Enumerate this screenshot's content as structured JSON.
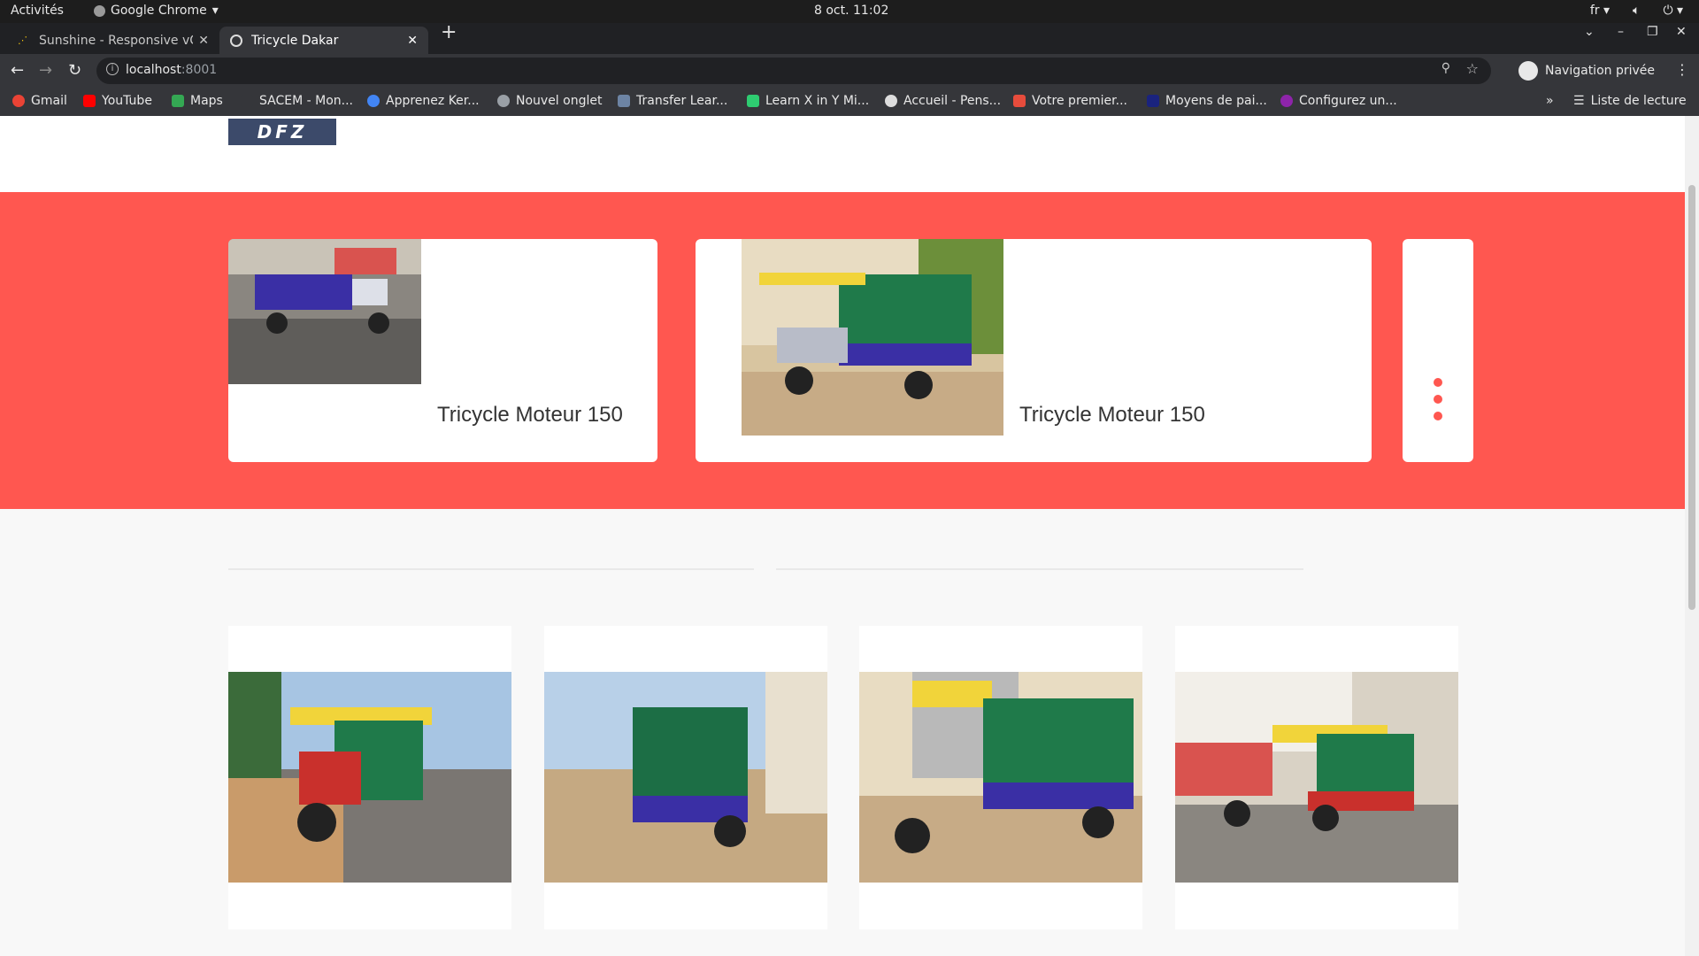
{
  "os": {
    "activities": "Activités",
    "app_name": "Google Chrome",
    "clock": "8 oct.  11:02",
    "lang": "fr"
  },
  "browser": {
    "tabs": [
      {
        "title": "Sunshine - Responsive vCa",
        "active": false
      },
      {
        "title": "Tricycle Dakar",
        "active": true
      }
    ],
    "url_host": "localhost",
    "url_port": ":8001",
    "profile_label": "Navigation privée",
    "bookmarks": [
      {
        "label": "Gmail",
        "color": "#ea4335"
      },
      {
        "label": "YouTube",
        "color": "#ff0000"
      },
      {
        "label": "Maps",
        "color": "#34a853"
      },
      {
        "label": "SACEM - Mon...",
        "color": "#35363a"
      },
      {
        "label": "Apprenez Ker...",
        "color": "#4285f4"
      },
      {
        "label": "Nouvel onglet",
        "color": "#9aa0a6"
      },
      {
        "label": "Transfer Lear...",
        "color": "#6d84a4"
      },
      {
        "label": "Learn X in Y Mi...",
        "color": "#2ecc71"
      },
      {
        "label": "Accueil - Pens...",
        "color": "#dddddd"
      },
      {
        "label": "Votre premier...",
        "color": "#e74c3c"
      },
      {
        "label": "Moyens de pai...",
        "color": "#1a237e"
      },
      {
        "label": "Configurez un...",
        "color": "#8e24aa"
      }
    ],
    "reading_list": "Liste de lecture"
  },
  "page": {
    "logo_text": "DFZ",
    "accent_color": "#ff5750",
    "products": [
      {
        "title": "Tricycle Moteur 150"
      },
      {
        "title": "Tricycle Moteur 150"
      }
    ]
  }
}
